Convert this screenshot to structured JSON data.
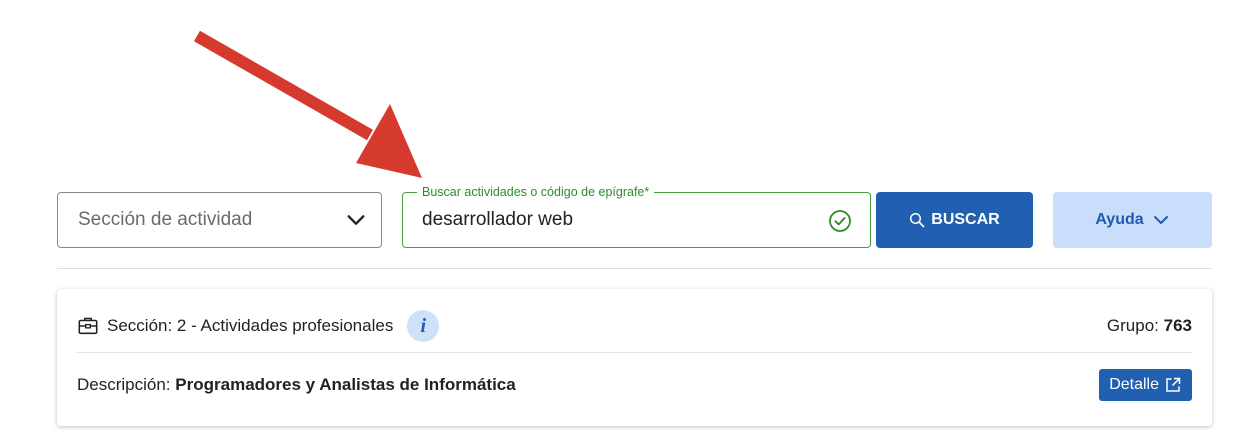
{
  "filters": {
    "section_select_placeholder": "Sección de actividad",
    "search_legend": "Buscar actividades o código de epígrafe*",
    "search_value": "desarrollador web",
    "search_button_label": "BUSCAR",
    "help_button_label": "Ayuda"
  },
  "result": {
    "section_label": "Sección: 2 - Actividades profesionales",
    "info_glyph": "i",
    "group_label": "Grupo:",
    "group_value": "763",
    "description_label": "Descripción:",
    "description_value": "Programadores y Analistas de Informática",
    "detail_button_label": "Detalle"
  },
  "colors": {
    "primary": "#2160b0",
    "help_bg": "#c9defa",
    "valid_green": "#2e8b2e",
    "arrow_red": "#d63a2f"
  },
  "icons": {
    "select": "chevron-down-icon",
    "valid": "check-circle-icon",
    "search": "search-icon",
    "help": "chevron-down-icon",
    "section": "briefcase-icon",
    "info": "info-icon",
    "detail": "external-link-icon",
    "annotation": "red-arrow"
  }
}
